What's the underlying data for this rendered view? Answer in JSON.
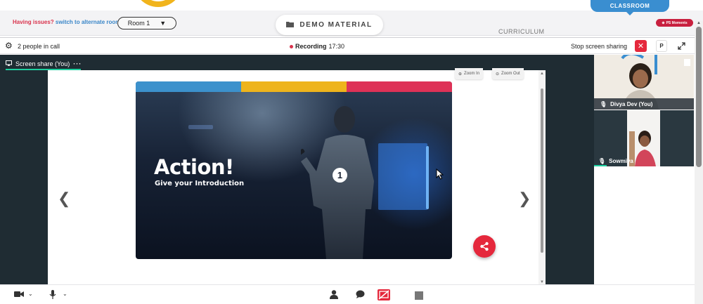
{
  "colors": {
    "accent_red": "#e5283c",
    "accent_blue": "#3a8ed0",
    "accent_teal": "#1ed0a0",
    "stage_dark": "#1f2c33",
    "slide_bar_blue": "#3c91cc",
    "slide_bar_yellow": "#eeb41c",
    "slide_bar_red": "#de3257"
  },
  "top": {
    "issue_text": "Having issues?",
    "issue_link": "switch to alternate room",
    "room_value": "Room 1",
    "demo_label": "DEMO MATERIAL",
    "curriculum_label": "CURRICULUM",
    "classroom_label": "CLASSROOM",
    "moments_label": "PS Moments"
  },
  "call": {
    "people_count": "2 people in call",
    "recording_label": "Recording",
    "recording_time": "17:30",
    "stop_share_label": "Stop screen sharing",
    "p_button": "P"
  },
  "share": {
    "tab_label": "Screen share (You)",
    "tab_menu": "···",
    "zoom_in": "Zoom In",
    "zoom_out": "Zoom Out"
  },
  "slide": {
    "title": "Action!",
    "subtitle": "Give your Introduction",
    "number": "1"
  },
  "participants": [
    {
      "name": "Divya Dev (You)"
    },
    {
      "name": "Sowmiya"
    }
  ],
  "icons": {
    "settings": "gear-icon",
    "close": "close-icon",
    "expand": "expand-icon",
    "folder": "folder-icon",
    "share": "share-icon",
    "camera": "camera-icon",
    "mic": "microphone-icon",
    "person": "person-icon",
    "chat": "chat-icon",
    "screen_share_off": "screen-share-off-icon",
    "stop": "stop-icon"
  }
}
